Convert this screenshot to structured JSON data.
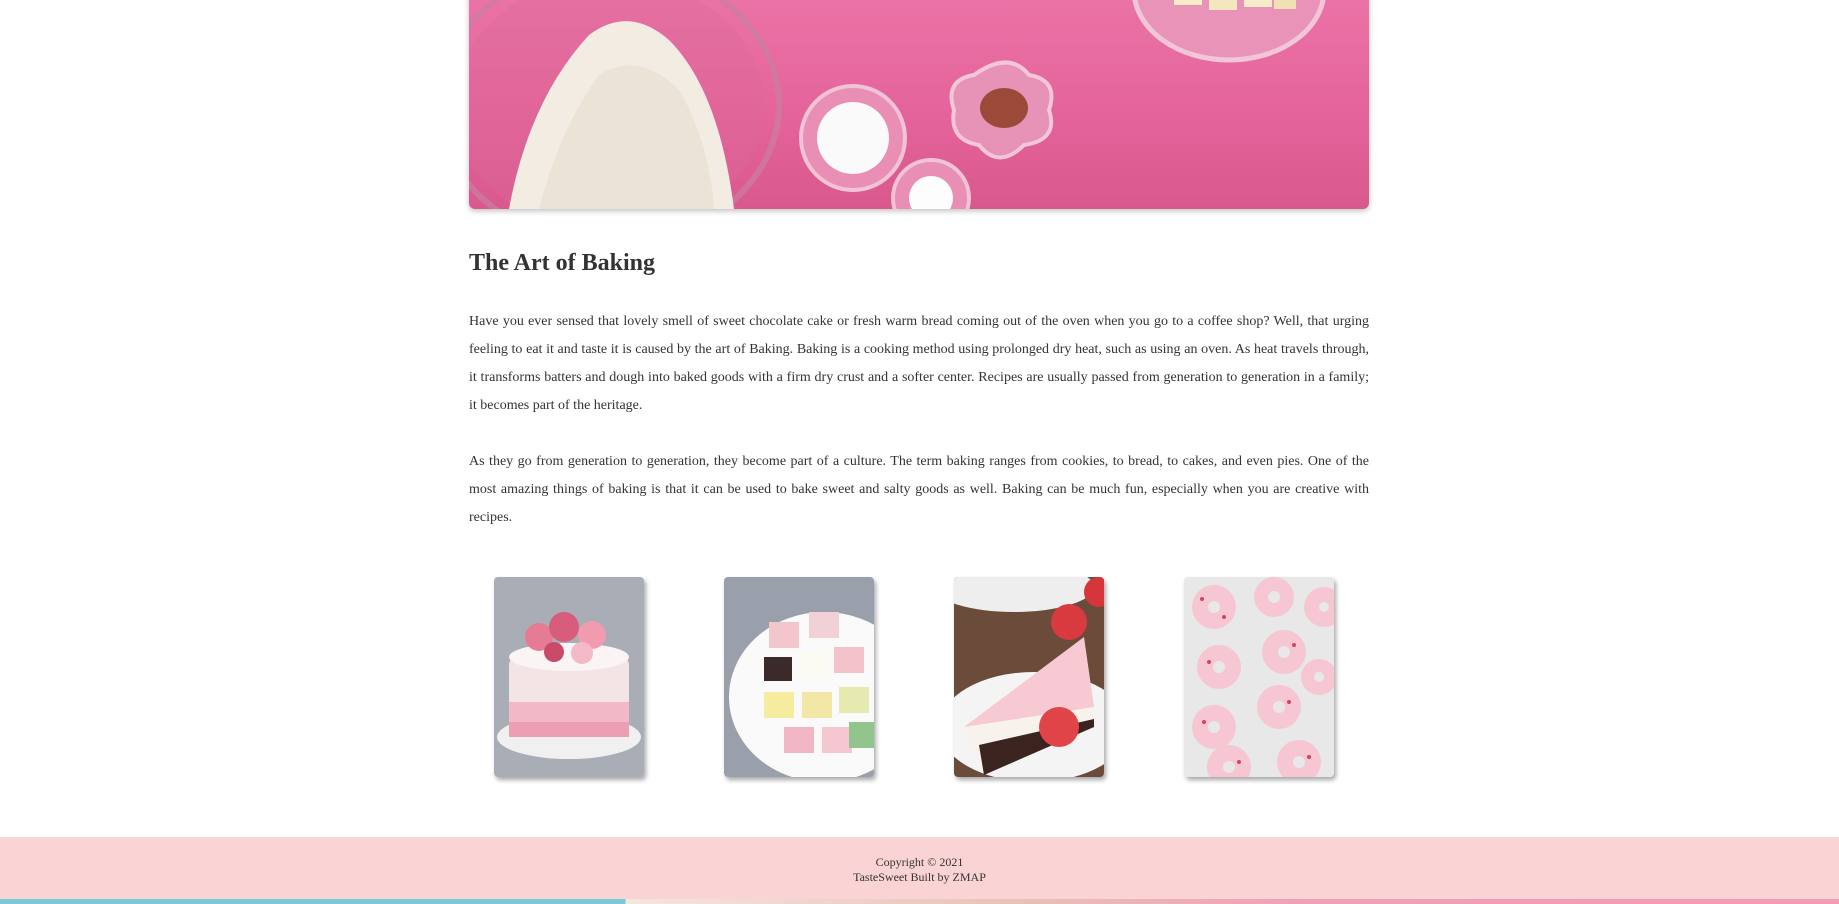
{
  "hero": {
    "image": "baking-ingredients-hero"
  },
  "article": {
    "title": "The Art of Baking",
    "paragraphs": [
      "Have you ever sensed that lovely smell of sweet chocolate cake or fresh warm bread coming out of the oven when you go to a coffee shop? Well, that urging feeling to eat it and taste it is caused by the art of Baking. Baking is a cooking method using prolonged dry heat, such as using an oven. As heat travels through, it transforms batters and dough into baked goods with a firm dry crust and a softer center. Recipes are usually passed from generation to generation in a family; it becomes part of the heritage.",
      "As they go from generation to generation, they become part of a culture. The term baking ranges from cookies, to bread, to cakes, and even pies. One of the most amazing things of baking is that it can be used to bake sweet and salty goods as well. Baking can be much fun, especially when you are creative with recipes."
    ]
  },
  "gallery": [
    {
      "image": "pink-drip-cake"
    },
    {
      "image": "petit-fours-plate"
    },
    {
      "image": "strawberry-cheesecake-slice"
    },
    {
      "image": "pink-donuts"
    }
  ],
  "footer": {
    "copyright": "Copyright © 2021",
    "credit": "TasteSweet Built by ZMAP"
  },
  "colors": {
    "hero_pink": "#e96aa0",
    "footer_bg": "#fad4d4",
    "text": "#333333"
  }
}
